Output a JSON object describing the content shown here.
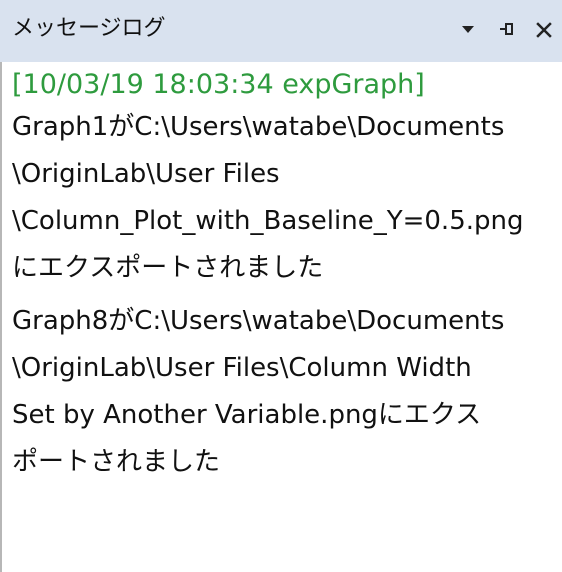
{
  "panel": {
    "title": "メッセージログ",
    "controls": [
      "dropdown-icon",
      "pin-icon",
      "close-icon"
    ]
  },
  "log": {
    "entry_header": "[10/03/19 18:03:34 expGraph]",
    "messages": [
      {
        "lines": [
          "Graph1がC:\\Users\\watabe\\Documents",
          "\\OriginLab\\User Files",
          "\\Column_Plot_with_Baseline_Y=0.5.png",
          "にエクスポートされました"
        ]
      },
      {
        "lines": [
          "Graph8がC:\\Users\\watabe\\Documents",
          "\\OriginLab\\User Files\\Column Width",
          "Set by Another Variable.pngにエクス",
          "ポートされました"
        ]
      }
    ]
  },
  "colors": {
    "titlebar_bg": "#d9e2ef",
    "header_text": "#2e9b3e",
    "body_text": "#111111"
  }
}
